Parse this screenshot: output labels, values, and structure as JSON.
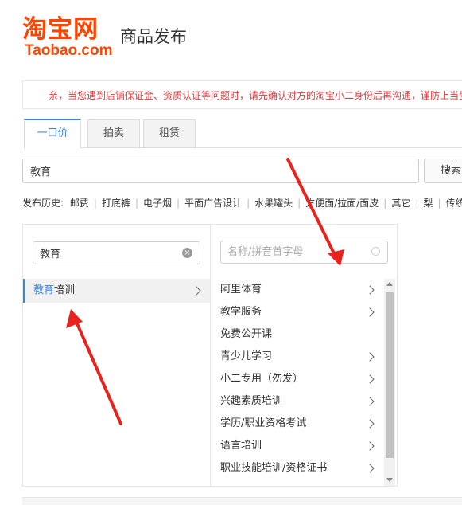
{
  "header": {
    "logo_cn": "淘宝网",
    "logo_en": "Taobao.com",
    "title": "商品发布"
  },
  "notice": {
    "text": "亲，当您遇到店铺保证金、资质认证等问题时，请先确认对方的淘宝小二身份后再沟通，谨防上当受骗"
  },
  "tabs": [
    {
      "label": "一口价",
      "active": true
    },
    {
      "label": "拍卖",
      "active": false
    },
    {
      "label": "租赁",
      "active": false
    }
  ],
  "search": {
    "value": "教育",
    "button_label": "搜索"
  },
  "history": {
    "label": "发布历史:",
    "items": [
      "邮费",
      "打底裤",
      "电子烟",
      "平面广告设计",
      "水果罐头",
      "方便面/拉面/面皮",
      "其它",
      "梨",
      "传统"
    ]
  },
  "category": {
    "col1": {
      "search_value": "教育",
      "items": [
        {
          "match": "教育",
          "rest": "培训",
          "selected": true,
          "has_children": true
        }
      ]
    },
    "col2": {
      "search_placeholder": "名称/拼音首字母",
      "items": [
        {
          "label": "阿里体育",
          "has_children": true
        },
        {
          "label": "教学服务",
          "has_children": true
        },
        {
          "label": "免费公开课",
          "has_children": false
        },
        {
          "label": "青少儿学习",
          "has_children": true
        },
        {
          "label": "小二专用（勿发）",
          "has_children": true
        },
        {
          "label": "兴趣素质培训",
          "has_children": true
        },
        {
          "label": "学历/职业资格考试",
          "has_children": true
        },
        {
          "label": "语言培训",
          "has_children": true
        },
        {
          "label": "职业技能培训/资格证书",
          "has_children": true
        }
      ]
    }
  },
  "colors": {
    "brand": "#ff4400",
    "accent": "#3983e6",
    "notice": "#e4393c",
    "annotation_arrow": "#e8231e"
  }
}
